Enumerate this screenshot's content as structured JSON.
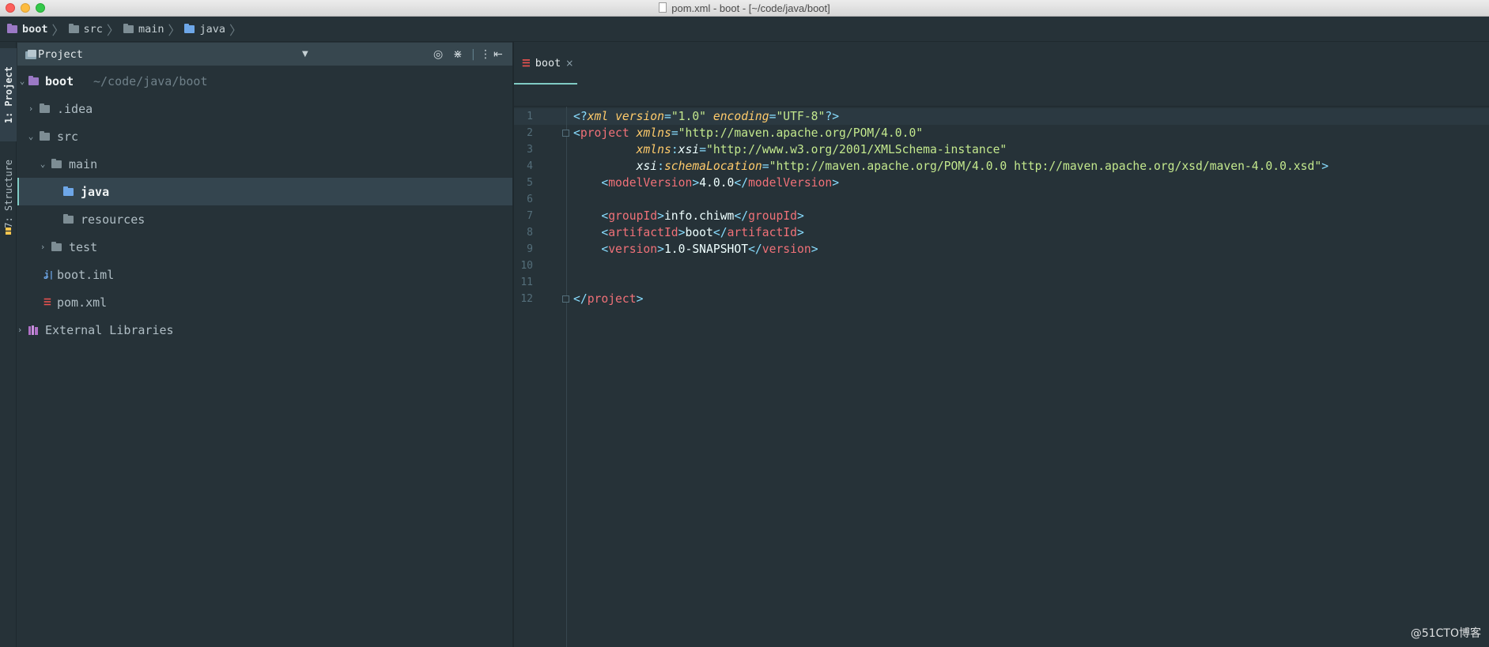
{
  "window": {
    "title": "pom.xml - boot - [~/code/java/boot]"
  },
  "breadcrumbs": [
    {
      "label": "boot",
      "icon": "module-folder-icon"
    },
    {
      "label": "src",
      "icon": "folder-icon"
    },
    {
      "label": "main",
      "icon": "folder-icon"
    },
    {
      "label": "java",
      "icon": "source-folder-icon"
    }
  ],
  "tool_strip": {
    "project_tab": "1: Project",
    "structure_tab": "7: Structure"
  },
  "project_panel": {
    "header_label": "Project",
    "tree": [
      {
        "label": "boot",
        "suffix": "~/code/java/boot",
        "depth": 0,
        "expanded": true
      },
      {
        "label": ".idea",
        "depth": 1,
        "expanded": false
      },
      {
        "label": "src",
        "depth": 1,
        "expanded": true
      },
      {
        "label": "main",
        "depth": 2,
        "expanded": true
      },
      {
        "label": "java",
        "depth": 3,
        "selected": true
      },
      {
        "label": "resources",
        "depth": 3
      },
      {
        "label": "test",
        "depth": 2,
        "expanded": false
      },
      {
        "label": "boot.iml",
        "depth": 1
      },
      {
        "label": "pom.xml",
        "depth": 1
      },
      {
        "label": "External Libraries",
        "depth": 0,
        "expanded": false
      }
    ]
  },
  "editor": {
    "tab_label": "boot",
    "close_glyph": "×",
    "line_numbers": [
      "1",
      "2",
      "3",
      "4",
      "5",
      "6",
      "7",
      "8",
      "9",
      "10",
      "11",
      "12"
    ],
    "code": {
      "l1_decl_open": "<?",
      "l1_xml": "xml",
      "l1_version_attr": "version",
      "l1_version_val": "\"1.0\"",
      "l1_enc_attr": "encoding",
      "l1_enc_val": "\"UTF-8\"",
      "l1_decl_close": "?>",
      "l2_tag": "project",
      "l2_attr": "xmlns",
      "l2_val": "\"http://maven.apache.org/POM/4.0.0\"",
      "l3_ns": "xmlns",
      "l3_attr": "xsi",
      "l3_val": "\"http://www.w3.org/2001/XMLSchema-instance\"",
      "l4_ns": "xsi",
      "l4_attr": "schemaLocation",
      "l4_val": "\"http://maven.apache.org/POM/4.0.0 http://maven.apache.org/xsd/maven-4.0.0.xsd\"",
      "l5_tag": "modelVersion",
      "l5_text": "4.0.0",
      "l7_tag": "groupId",
      "l7_text": "info.chiwm",
      "l8_tag": "artifactId",
      "l8_text": "boot",
      "l9_tag": "version",
      "l9_text": "1.0-SNAPSHOT",
      "l12_tag": "project"
    }
  },
  "watermark": "@51CTO博客",
  "colors": {
    "background": "#263238",
    "accent": "#80cbc4",
    "tag": "#f07178",
    "attribute": "#ffcb6b",
    "string": "#c3e88d",
    "punctuation": "#89ddff"
  }
}
